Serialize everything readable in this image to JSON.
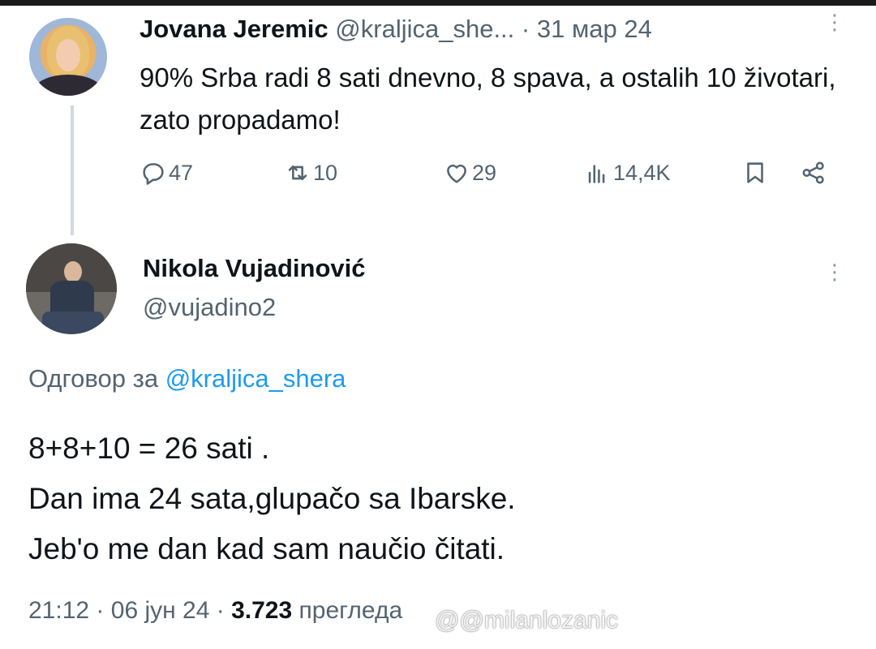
{
  "tweet": {
    "author_name": "Jovana Jeremic",
    "handle": "@kraljica_she...",
    "separator": "·",
    "date": "31 мар 24",
    "more_glyph": "⋮",
    "text": "90% Srba radi 8 sati dnevno, 8 spava, a ostalih 10 životari, zato propadamo!",
    "actions": {
      "replies": "47",
      "retweets": "10",
      "likes": "29",
      "views": "14,4K",
      "reply_icon": "reply-icon",
      "retweet_icon": "retweet-icon",
      "like_icon": "heart-icon",
      "views_icon": "views-icon",
      "bookmark_icon": "bookmark-icon",
      "share_icon": "share-icon"
    }
  },
  "reply": {
    "author_name": "Nikola Vujadinović",
    "handle": "@vujadino2",
    "more_glyph": "⋮",
    "replying_prefix": "Одговор за",
    "replying_to": "@kraljica_shera",
    "lines": [
      "8+8+10 = 26 sati .",
      "Dan ima 24 sata,glupačo sa Ibarske.",
      "Jeb'o me dan kad sam naučio čitati."
    ],
    "time": "21:12",
    "separator": "·",
    "date": "06 јун 24",
    "views_count": "3.723",
    "views_label": "прегледа"
  },
  "watermark": {
    "text": "@milanlozanic",
    "icon": "threads-icon"
  },
  "colors": {
    "text": "#0f1419",
    "secondary": "#536471",
    "link": "#1d9bf0",
    "thread_line": "#cfd9de"
  }
}
